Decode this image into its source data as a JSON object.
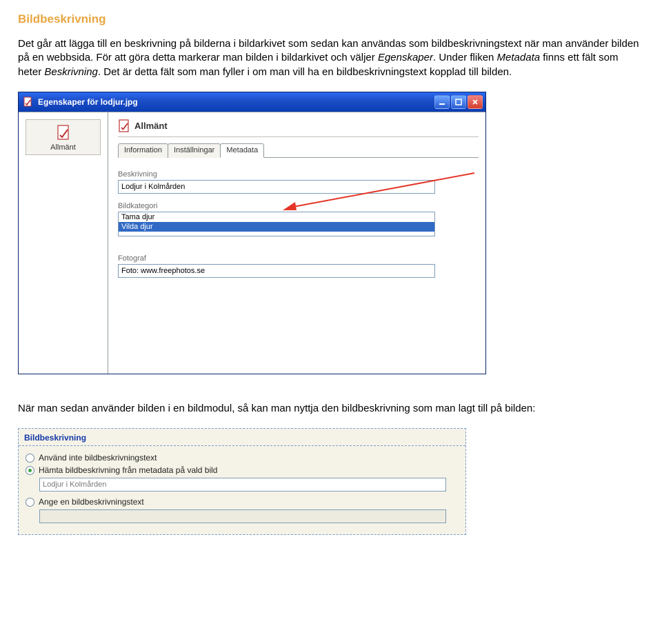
{
  "doc": {
    "heading": "Bildbeskrivning",
    "p1_a": "Det går att lägga till en beskrivning på bilderna i bildarkivet som sedan kan användas som bildbeskrivningstext när man använder bilden på en webbsida. För att göra detta markerar man bilden i bildarkivet och väljer ",
    "p1_italic1": "Egenskaper",
    "p1_b": ". Under fliken ",
    "p1_italic2": "Metadata",
    "p1_c": " finns ett fält som heter ",
    "p1_italic3": "Beskrivning",
    "p1_d": ". Det är detta fält som man fyller i om man vill ha en bildbeskrivningstext kopplad till bilden.",
    "p2": "När man sedan använder bilden i en bildmodul, så kan man nyttja den bildbeskrivning som man lagt till på bilden:"
  },
  "win": {
    "title": "Egenskaper för lodjur.jpg",
    "left_item": "Allmänt",
    "panel_title": "Allmänt",
    "tabs": {
      "information": "Information",
      "installningar": "Inställningar",
      "metadata": "Metadata"
    },
    "form": {
      "beskrivning_label": "Beskrivning",
      "beskrivning_value": "Lodjur i Kolmården",
      "bildkategori_label": "Bildkategori",
      "bildkategori_opt1": "Tama djur",
      "bildkategori_opt2": "Vilda djur",
      "fotograf_label": "Fotograf",
      "fotograf_value": "Foto: www.freephotos.se"
    }
  },
  "panel2": {
    "legend": "Bildbeskrivning",
    "opt1": "Använd inte bildbeskrivningstext",
    "opt2": "Hämta bildbeskrivning från metadata på vald bild",
    "opt2_value": "Lodjur i Kolmården",
    "opt3": "Ange en bildbeskrivningstext",
    "opt3_value": ""
  }
}
